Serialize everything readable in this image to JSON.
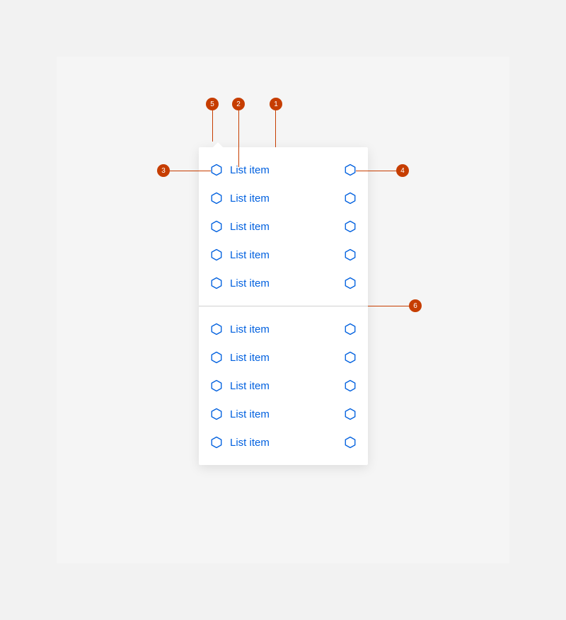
{
  "callouts": {
    "c1": "1",
    "c2": "2",
    "c3": "3",
    "c4": "4",
    "c5": "5",
    "c6": "6"
  },
  "panel": {
    "groups": [
      {
        "items": [
          {
            "label": "List item"
          },
          {
            "label": "List item"
          },
          {
            "label": "List item"
          },
          {
            "label": "List item"
          },
          {
            "label": "List item"
          }
        ]
      },
      {
        "items": [
          {
            "label": "List item"
          },
          {
            "label": "List item"
          },
          {
            "label": "List item"
          },
          {
            "label": "List item"
          },
          {
            "label": "List item"
          }
        ]
      }
    ]
  }
}
